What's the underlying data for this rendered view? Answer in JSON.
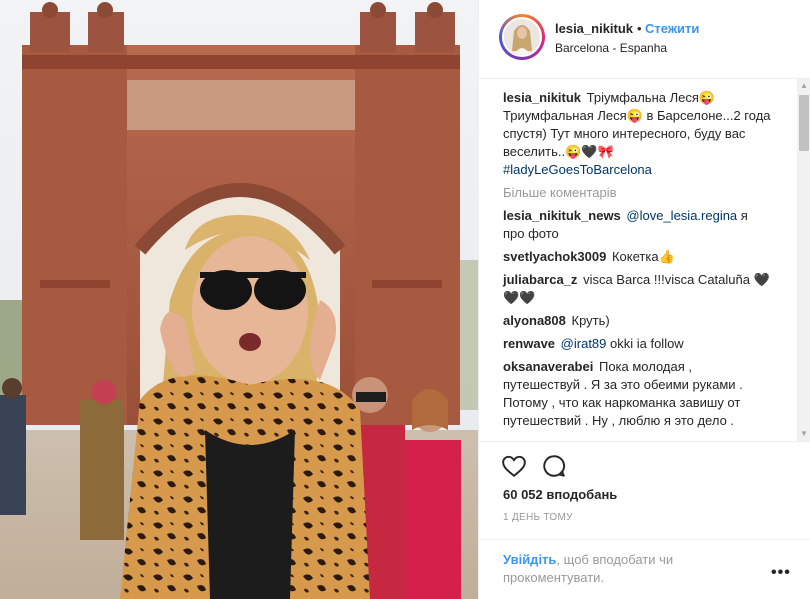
{
  "post": {
    "photo_alt": "Photo of a woman in leopard print and sunglasses in front of the Arc de Triomf"
  },
  "header": {
    "username": "lesia_nikituk",
    "separator": "•",
    "follow_label": "Стежити",
    "location": "Barcelona - Espanha"
  },
  "caption": {
    "user": "lesia_nikituk",
    "text": "Тріумфальна Леся😜 Триумфальная Леся😜 в Барселоне...2 года спустя) Тут много интересного, буду вас веселить..😜🖤🎀",
    "hashtag": "#ladyLeGoesToBarcelona"
  },
  "load_more": "Більше коментарів",
  "comments": [
    {
      "user": "lesia_nikituk_news",
      "mention": "@love_lesia.regina",
      "text": " я про фото"
    },
    {
      "user": "svetlyachok3009",
      "mention": "",
      "text": "Кокетка👍"
    },
    {
      "user": "juliabarca_z",
      "mention": "",
      "text": "visca Barca !!!visca Cataluña 🖤🖤🖤"
    },
    {
      "user": "alyona808",
      "mention": "",
      "text": "Круть)"
    },
    {
      "user": "renwave",
      "mention": "@irat89",
      "text": " okki ia follow"
    },
    {
      "user": "oksanaverabei",
      "mention": "",
      "text": "Пока молодая , путешествуй . Я за это обеими руками . Потому , что как наркоманка завишу от путешествий . Ну , люблю я это дело ."
    }
  ],
  "actions": {
    "like_icon": "heart-icon",
    "comment_icon": "comment-icon",
    "likes_text": "60 052 вподобань",
    "time_text": "1 ДЕНЬ ТОМУ"
  },
  "login": {
    "link_text": "Увійдіть",
    "rest_text": ", щоб вподобати чи прокоментувати.",
    "more_options": "•••"
  },
  "colors": {
    "link_blue": "#3897f0",
    "hashtag_navy": "#003569",
    "muted_gray": "#999999"
  }
}
